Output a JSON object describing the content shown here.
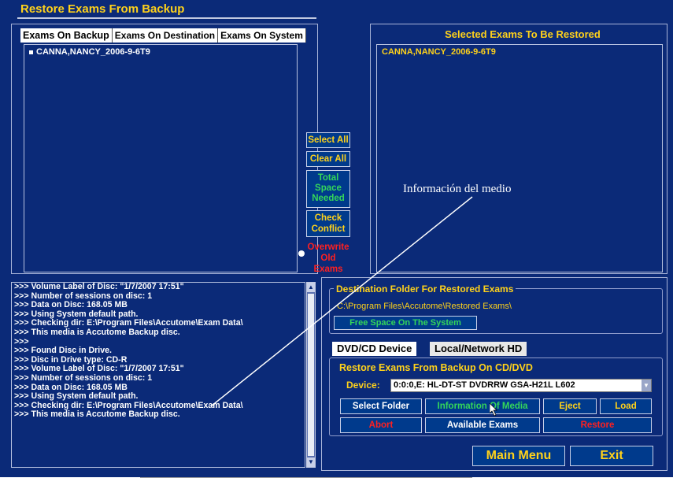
{
  "window": {
    "title": "Restore Exams From Backup"
  },
  "tabs": [
    "Exams On Backup",
    "Exams On Destination",
    "Exams On System"
  ],
  "backup_list": {
    "items": [
      "CANNA,NANCY_2006-9-6T9"
    ]
  },
  "selected": {
    "title": "Selected Exams To Be Restored",
    "items": [
      "CANNA,NANCY_2006-9-6T9"
    ]
  },
  "buttons": {
    "select_all": "Select All",
    "clear_all": "Clear All",
    "total_space": "Total Space Needed",
    "check_conflict": "Check Conflict",
    "overwrite": "Overwrite Old Exams"
  },
  "log": {
    "lines": [
      ">>> Volume Label of Disc: \"1/7/2007 17:51\"",
      ">>> Number of sessions on disc: 1",
      ">>> Data on Disc: 168.05 MB",
      ">>> Using System default path.",
      ">>> Checking dir: E:\\Program Files\\Accutome\\Exam Data\\",
      ">>> This media is Accutome Backup disc.",
      ">>>",
      ">>> Found Disc in Drive.",
      ">>> Disc in Drive type: CD-R",
      ">>> Volume Label of Disc: \"1/7/2007 17:51\"",
      ">>> Number of sessions on disc: 1",
      ">>> Data on Disc: 168.05 MB",
      ">>> Using System default path.",
      ">>> Checking dir: E:\\Program Files\\Accutome\\Exam Data\\",
      ">>> This media is Accutome Backup disc."
    ]
  },
  "destination": {
    "label": "Destination Folder For Restored Exams",
    "path": "C:\\Program Files\\Accutome\\Restored Exams\\",
    "free_space": "Free Space On The System"
  },
  "device_tabs": [
    "DVD/CD Device",
    "Local/Network HD"
  ],
  "restore_group": {
    "label": "Restore Exams From Backup On CD/DVD",
    "device_label": "Device:",
    "device_value": "0:0:0,E: HL-DT-ST DVDRRW GSA-H21L  L602",
    "select_folder": "Select Folder",
    "info_media": "Information Of Media",
    "eject": "Eject",
    "load": "Load",
    "abort": "Abort",
    "available_exams": "Available Exams",
    "restore": "Restore"
  },
  "footer": {
    "main_menu": "Main Menu",
    "exit": "Exit"
  },
  "annotation": "Información del medio",
  "colors": {
    "background": "#0b2a78",
    "accent": "#ffd21a",
    "green": "#34d65a",
    "red": "#ff2020"
  }
}
